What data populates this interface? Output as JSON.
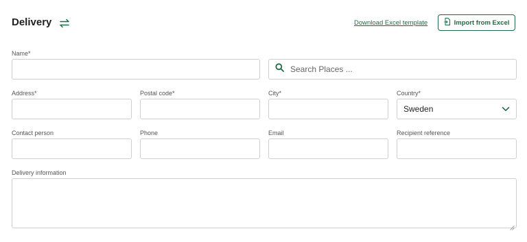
{
  "header": {
    "title": "Delivery",
    "download_link": "Download Excel template",
    "import_button": "Import from Excel"
  },
  "form": {
    "name_label": "Name*",
    "search_placeholder": "Search Places ...",
    "address_label": "Address*",
    "postal_label": "Postal code*",
    "city_label": "City*",
    "country_label": "Country*",
    "country_value": "Sweden",
    "contact_label": "Contact person",
    "phone_label": "Phone",
    "email_label": "Email",
    "recipient_label": "Recipient reference",
    "delivery_info_label": "Delivery information"
  },
  "colors": {
    "accent": "#1c6b43",
    "border": "#cfcfcf"
  }
}
